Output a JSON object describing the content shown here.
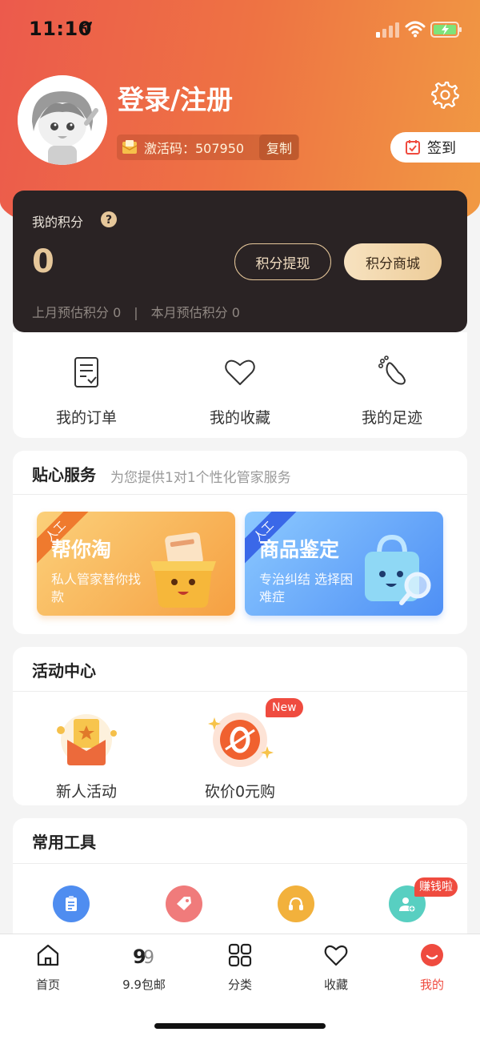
{
  "status_bar": {
    "time": "11:10"
  },
  "profile": {
    "title": "登录/注册",
    "activation_code_text": "激活码：507950",
    "copy_label": "复制",
    "signin_label": "签到"
  },
  "points": {
    "label": "我的积分",
    "value": "0",
    "withdraw_label": "积分提现",
    "mall_label": "积分商城",
    "last_month": "上月预估积分 0",
    "separator": "|",
    "this_month": "本月预估积分 0"
  },
  "quick_links": [
    {
      "label": "我的订单",
      "icon": "order-list-icon"
    },
    {
      "label": "我的收藏",
      "icon": "heart-icon"
    },
    {
      "label": "我的足迹",
      "icon": "footprint-icon"
    }
  ],
  "service": {
    "title": "贴心服务",
    "subtitle": "为您提供1对1个性化管家服务",
    "tiles": [
      {
        "ribbon": "人工",
        "title": "帮你淘",
        "desc": "私人管家替你找款"
      },
      {
        "ribbon": "人工",
        "title": "商品鉴定",
        "desc": "专治纠结 选择困难症"
      }
    ]
  },
  "activity": {
    "title": "活动中心",
    "items": [
      {
        "label": "新人活动",
        "icon": "gift-envelope-icon"
      },
      {
        "label": "砍价0元购",
        "icon": "bargain-zero-icon"
      }
    ],
    "new_badge": "New"
  },
  "tools": {
    "title": "常用工具",
    "items": [
      {
        "icon": "clipboard-icon",
        "color": "#4f8df0"
      },
      {
        "icon": "tag-icon",
        "color": "#f07b7b"
      },
      {
        "icon": "headset-icon",
        "color": "#f2b13c"
      },
      {
        "icon": "add-user-icon",
        "color": "#58cfc1"
      }
    ],
    "earn_badge": "赚钱啦"
  },
  "tab_bar": {
    "items": [
      {
        "label": "首页",
        "icon": "home-icon"
      },
      {
        "label": "9.9包邮",
        "icon": "nine-nine-icon"
      },
      {
        "label": "分类",
        "icon": "category-grid-icon"
      },
      {
        "label": "收藏",
        "icon": "heart-icon"
      },
      {
        "label": "我的",
        "icon": "profile-smile-icon"
      }
    ],
    "active_index": 4
  },
  "colors": {
    "header_gradient_start": "#ec5a4c",
    "header_gradient_end": "#f19a43",
    "points_card": "#2a2324",
    "gold": "#e6c79a",
    "active_tab": "#ef4b3f"
  }
}
